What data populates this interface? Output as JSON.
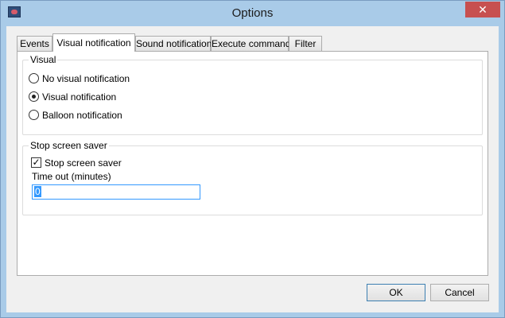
{
  "window": {
    "title": "Options",
    "close_glyph": "✕"
  },
  "tabs": [
    {
      "label": "Events",
      "active": false
    },
    {
      "label": "Visual notification",
      "active": true
    },
    {
      "label": "Sound notification",
      "active": false
    },
    {
      "label": "Execute command",
      "active": false
    },
    {
      "label": "Filter",
      "active": false
    }
  ],
  "visual_group": {
    "label": "Visual",
    "options": [
      {
        "label": "No visual notification",
        "selected": false
      },
      {
        "label": "Visual notification",
        "selected": true
      },
      {
        "label": "Balloon notification",
        "selected": false
      }
    ]
  },
  "screensaver_group": {
    "label": "Stop screen saver",
    "checkbox_label": "Stop screen saver",
    "checkbox_checked": true,
    "timeout_label": "Time out (minutes)",
    "timeout_value": "0"
  },
  "buttons": {
    "ok": "OK",
    "cancel": "Cancel"
  },
  "icons": {
    "app": "app-window-icon",
    "close": "close-icon",
    "check": "checkmark-icon"
  },
  "colors": {
    "titlebar": "#a9cbe8",
    "close_button": "#c75050",
    "focus": "#3399ff"
  }
}
